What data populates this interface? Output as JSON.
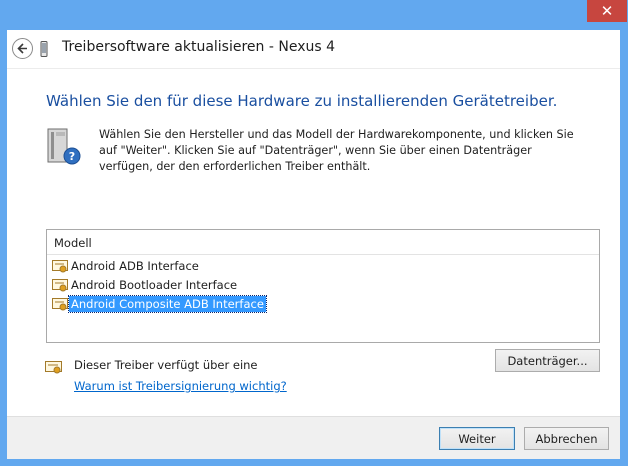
{
  "window": {
    "title": "Treibersoftware aktualisieren - Nexus 4",
    "close_label": "✕",
    "frame_color": "#62a8ef",
    "close_color": "#c7463f"
  },
  "main": {
    "heading": "Wählen Sie den für diese Hardware zu installierenden Gerätetreiber.",
    "instructions": "Wählen Sie den Hersteller und das Modell der Hardwarekomponente, und klicken Sie auf \"Weiter\". Klicken Sie auf \"Datenträger\", wenn Sie über einen Datenträger verfügen, der den erforderlichen Treiber enthält.",
    "heading_color": "#1a4fa0"
  },
  "model_list": {
    "header": "Modell",
    "items": [
      {
        "label": "Android ADB Interface",
        "selected": false,
        "icon": "certificate-icon"
      },
      {
        "label": "Android Bootloader Interface",
        "selected": false,
        "icon": "certificate-icon"
      },
      {
        "label": "Android Composite ADB Interface",
        "selected": true,
        "icon": "certificate-icon"
      }
    ],
    "selection_color": "#3399ff"
  },
  "driver": {
    "info": "Dieser Treiber verfügt über eine",
    "link": "Warum ist Treibersignierung wichtig?",
    "link_color": "#0066cc"
  },
  "buttons": {
    "disk": "Datenträger...",
    "next": "Weiter",
    "cancel": "Abbrechen"
  }
}
